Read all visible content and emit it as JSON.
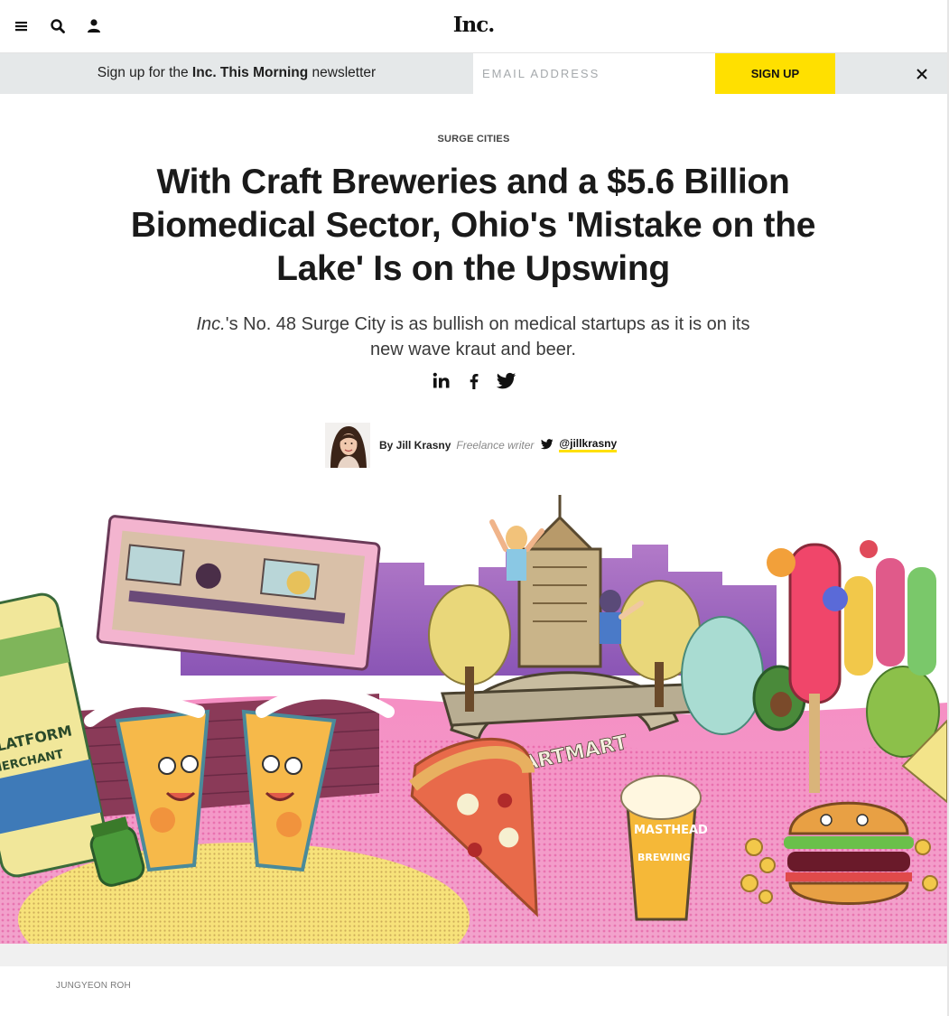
{
  "header": {
    "logo": "Inc.",
    "icons": [
      "menu-icon",
      "search-icon",
      "user-icon"
    ]
  },
  "newsletter": {
    "prefix": "Sign up for the ",
    "name": "Inc. This Morning",
    "suffix": " newsletter",
    "email_placeholder": "EMAIL ADDRESS",
    "button_label": "SIGN UP"
  },
  "article": {
    "kicker": "SURGE CITIES",
    "headline": "With Craft Breweries and a $5.6 Billion Biomedical Sector, Ohio's 'Mistake on the Lake' Is on the Upswing",
    "dek_pub": "Inc.",
    "dek_rest": "'s No. 48 Surge City is as bullish on medical startups as it is on its new wave kraut and beer.",
    "share_icons": [
      "linkedin-icon",
      "facebook-icon",
      "twitter-icon"
    ],
    "byline": {
      "by": "By Jill Krasny",
      "role": "Freelance writer",
      "twitter": "@jillkrasny"
    },
    "hero_art": {
      "sign_text": "STARTMART",
      "glass_text_1": "MASTHEAD",
      "glass_text_2": "BREWING",
      "can_text": "PLATFORM",
      "can_text_2": "MERCHANT"
    },
    "image_credit": "JUNGYEON ROH"
  },
  "colors": {
    "accent": "#ffe000",
    "newsletter_bg": "#e5e8e9"
  }
}
